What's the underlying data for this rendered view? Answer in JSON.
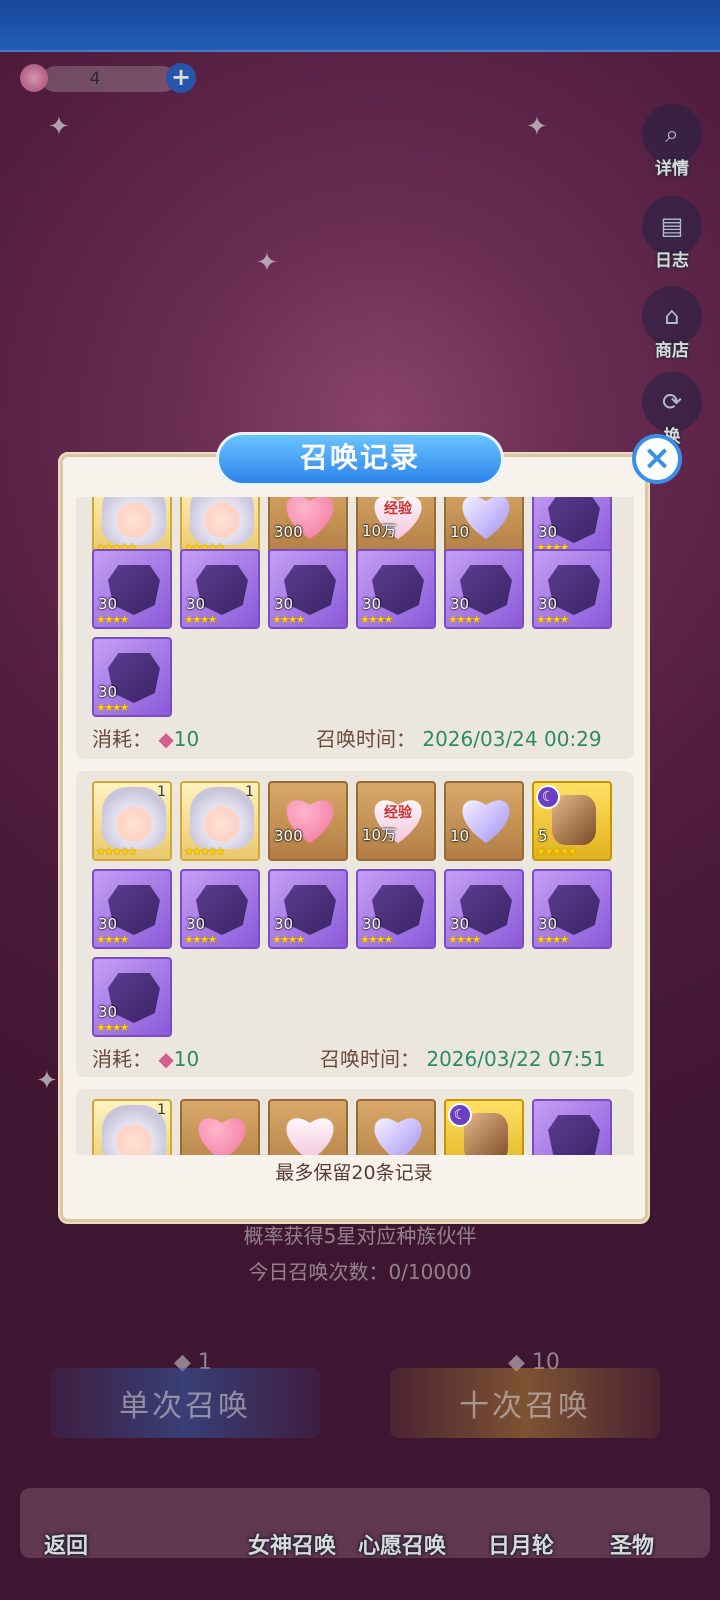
{
  "resource": {
    "count": "4",
    "add": "+"
  },
  "side": [
    {
      "label": "详情"
    },
    {
      "label": "日志"
    },
    {
      "label": "商店"
    },
    {
      "label": "换"
    }
  ],
  "under": {
    "prob": "概率获得5星对应种族伙伴",
    "today": "今日召唤次数：0/10000"
  },
  "buttons": {
    "single": "单次召唤",
    "ten": "十次召唤",
    "single_cost": "1",
    "ten_cost": "10"
  },
  "nav": {
    "back": "返回",
    "goddess": "女神召唤",
    "wish": "心愿召唤",
    "sunmoon": "日月轮",
    "relic": "圣物"
  },
  "modal": {
    "title": "召唤记录",
    "close": "×",
    "footer": "最多保留20条记录"
  },
  "records": [
    {
      "cost_label": "消耗：",
      "cost": "10",
      "time_label": "召唤时间：",
      "time": "2026/03/24 00:29",
      "row1": [
        {
          "kind": "char",
          "stars": "★★★★★"
        },
        {
          "kind": "char",
          "stars": "★★★★★"
        },
        {
          "kind": "heart",
          "qty": "300"
        },
        {
          "kind": "exp",
          "qty": "10万",
          "text": "经验"
        },
        {
          "kind": "crystal",
          "qty": "10"
        },
        {
          "kind": "purple",
          "qty": "30",
          "stars": "★★★★"
        }
      ],
      "row2": [
        "30",
        "30",
        "30",
        "30",
        "30",
        "30"
      ],
      "row3": "30"
    },
    {
      "cost_label": "消耗：",
      "cost": "10",
      "time_label": "召唤时间：",
      "time": "2026/03/22 07:51",
      "row1": [
        {
          "kind": "char",
          "stars": "★★★★★",
          "lvl": "1"
        },
        {
          "kind": "char",
          "stars": "★★★★★",
          "lvl": "1"
        },
        {
          "kind": "heart",
          "qty": "300"
        },
        {
          "kind": "exp",
          "qty": "10万",
          "text": "经验"
        },
        {
          "kind": "crystal",
          "qty": "10"
        },
        {
          "kind": "stone",
          "qty": "5",
          "stars": "★★★★★"
        }
      ],
      "row2": [
        "30",
        "30",
        "30",
        "30",
        "30",
        "30"
      ],
      "row3": "30"
    },
    {
      "row1": [
        {
          "kind": "char",
          "lvl": "1"
        },
        {
          "kind": "heart"
        },
        {
          "kind": "exp"
        },
        {
          "kind": "crystal"
        },
        {
          "kind": "stone"
        },
        {
          "kind": "purple"
        }
      ]
    }
  ],
  "star4": "★★★★"
}
